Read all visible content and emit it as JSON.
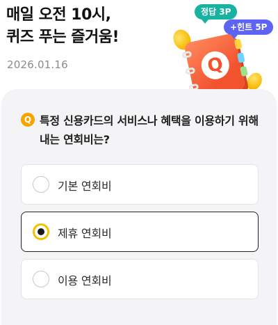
{
  "header": {
    "title_line1": "매일 오전 10시,",
    "title_line2": "퀴즈 푸는 즐거움!",
    "date": "2026.01.16"
  },
  "illustration": {
    "answer_bubble": "정답 3P",
    "hint_bubble": "+힌트 5P",
    "book_letter": "Q"
  },
  "quiz": {
    "badge": "Q",
    "question": "특정 신용카드의 서비스나 혜택을 이용하기 위해 내는 연회비는?",
    "options": [
      {
        "label": "기본 연회비",
        "selected": false
      },
      {
        "label": "제휴 연회비",
        "selected": true
      },
      {
        "label": "이용 연회비",
        "selected": false
      }
    ]
  },
  "colors": {
    "answer_bubble": "#17b2a0",
    "hint_bubble": "#5d63f2",
    "badge": "#f6a400",
    "selected_radio": "#f6c000",
    "book": "#f2522e"
  }
}
